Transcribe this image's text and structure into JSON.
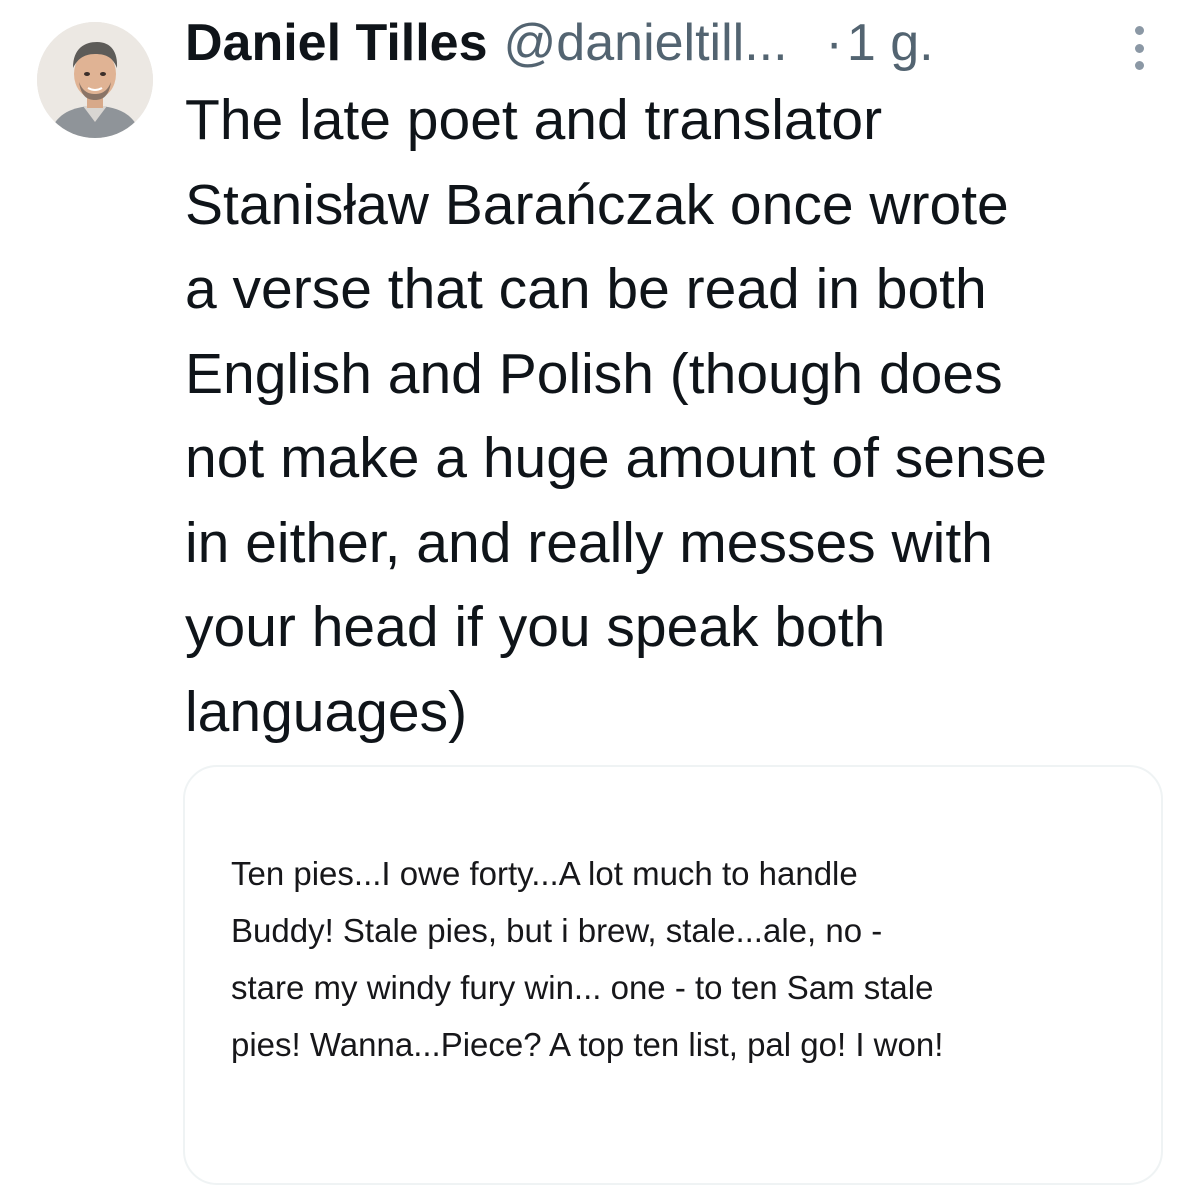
{
  "tweet": {
    "author_name": "Daniel Tilles",
    "author_handle": "@danieltill...",
    "separator": "·",
    "time": "1 g.",
    "text_lines": [
      "The late poet and translator",
      "Stanisław Barańczak once wrote",
      "a verse that can be read in both",
      "English and Polish (though does",
      "not make a huge amount of sense",
      "in either, and really messes with",
      "your head if you speak both",
      "languages)"
    ],
    "media_text_lines": [
      "Ten pies...I owe forty...A lot much to handle",
      "Buddy! Stale pies, but i brew, stale...ale, no -",
      "stare my windy fury win... one - to ten Sam stale",
      "pies! Wanna...Piece? A top ten list, pal go! I won!"
    ]
  },
  "icons": {
    "more": "more-vertical-icon",
    "avatar": "avatar-photo"
  },
  "colors": {
    "text": "#0f1419",
    "secondary": "#536471",
    "card_border": "#eff3f4"
  }
}
